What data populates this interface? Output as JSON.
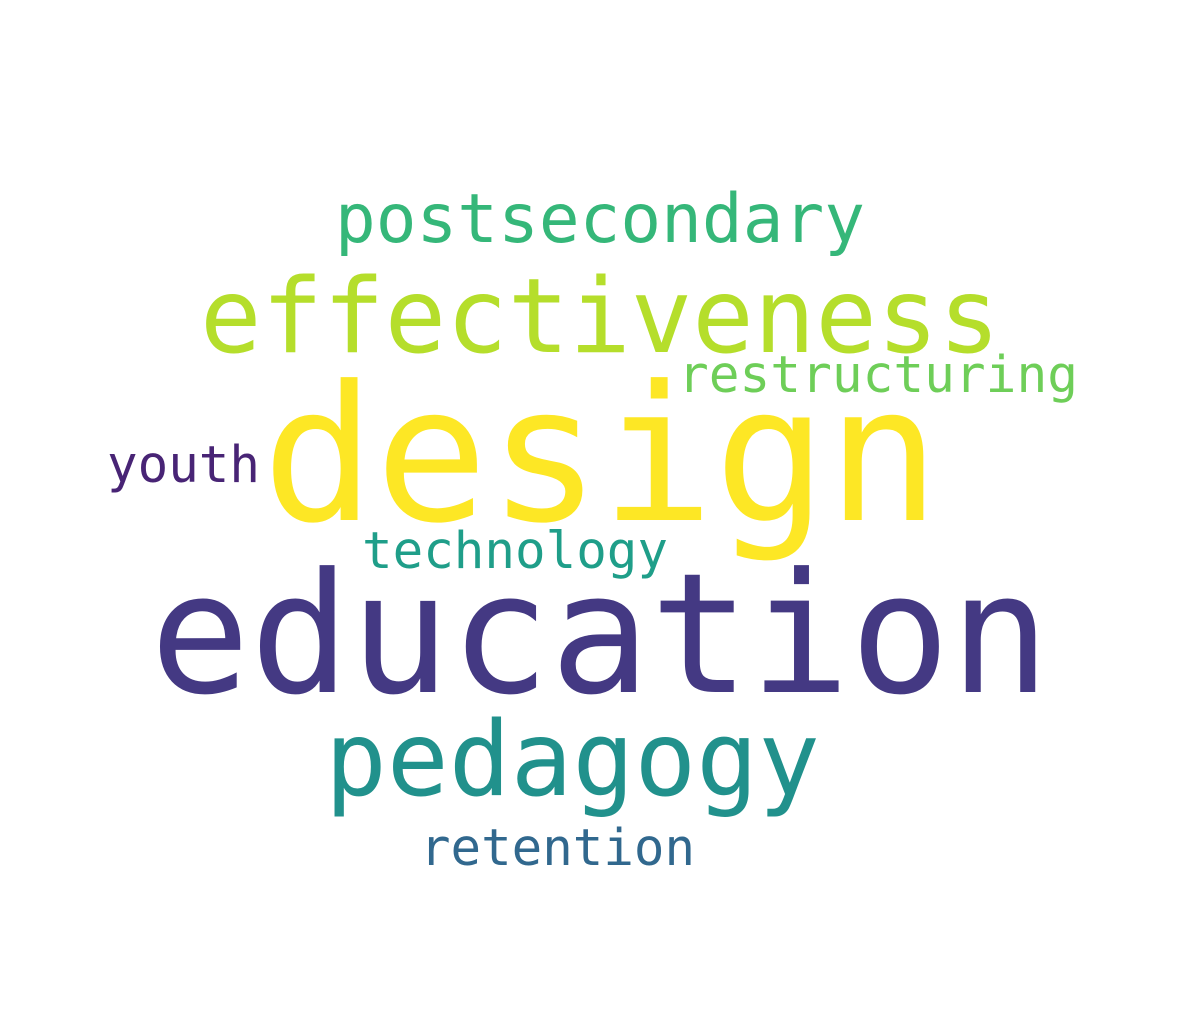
{
  "wordcloud": {
    "words": [
      {
        "text": "education",
        "color": "#443983"
      },
      {
        "text": "design",
        "color": "#fde725"
      },
      {
        "text": "effectiveness",
        "color": "#b5de2b"
      },
      {
        "text": "pedagogy",
        "color": "#21918c"
      },
      {
        "text": "postsecondary",
        "color": "#35b779"
      },
      {
        "text": "restructuring",
        "color": "#6ece58"
      },
      {
        "text": "technology",
        "color": "#1f9e89"
      },
      {
        "text": "retention",
        "color": "#31688e"
      },
      {
        "text": "youth",
        "color": "#482475"
      }
    ]
  }
}
